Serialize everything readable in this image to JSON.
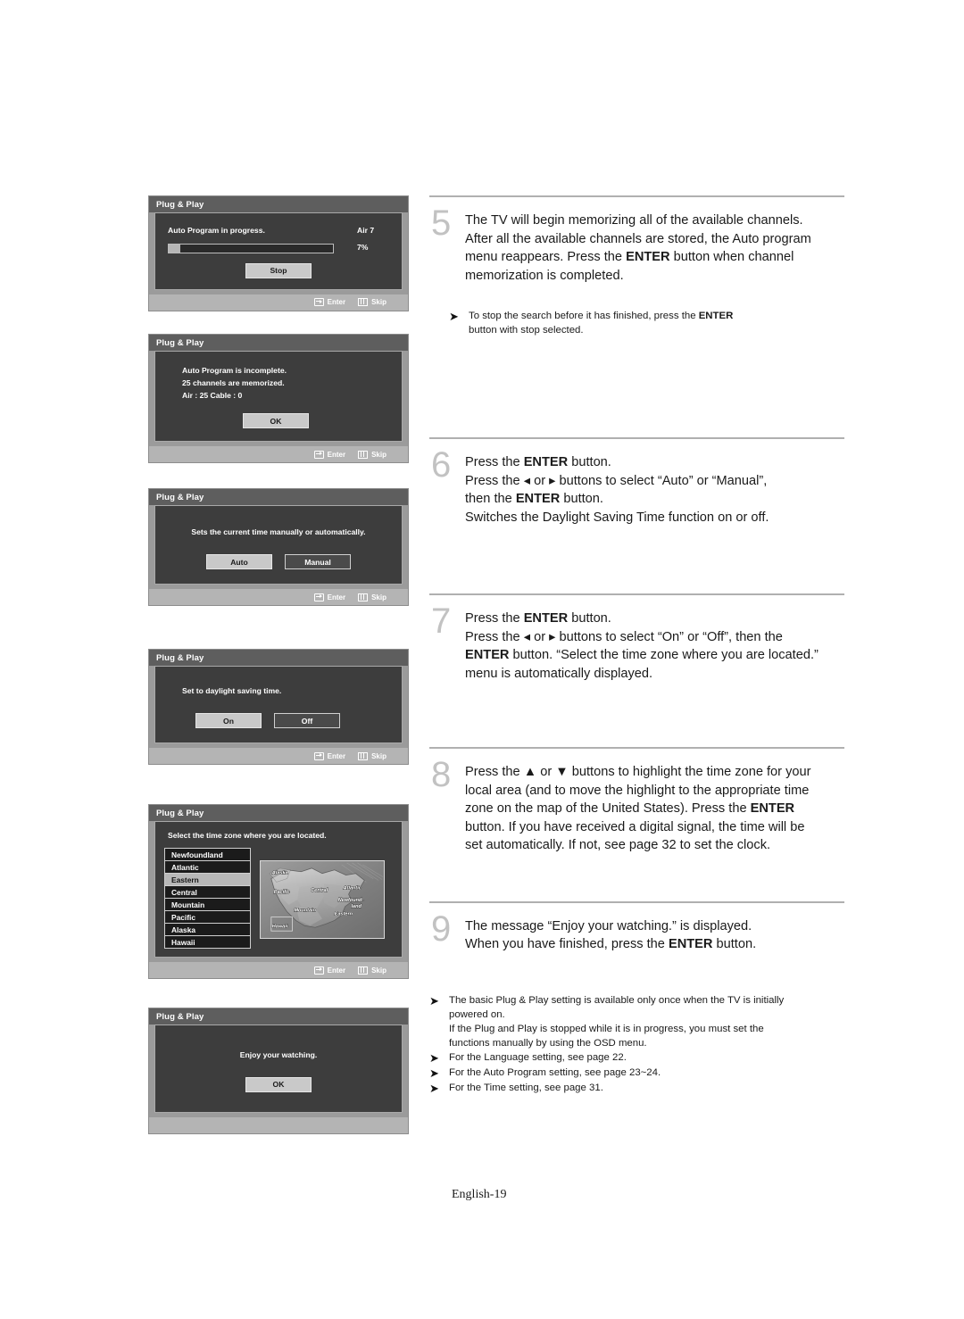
{
  "page": {
    "footer": "English-19"
  },
  "osd": {
    "title": "Plug & Play",
    "footer": {
      "enter": "Enter",
      "skip": "Skip"
    },
    "dialog_auto_program": {
      "message": "Auto Program in progress.",
      "channel": "Air 7",
      "percent": "7%",
      "progress_value": 7,
      "button": "Stop"
    },
    "dialog_incomplete": {
      "line1": "Auto Program is incomplete.",
      "line2": "25 channels are memorized.",
      "line3": "Air : 25    Cable : 0",
      "button": "OK"
    },
    "dialog_clock_mode": {
      "message": "Sets the current time manually or automatically.",
      "option_selected": "Auto",
      "option_other": "Manual"
    },
    "dialog_dst": {
      "message": "Set to daylight saving time.",
      "option_selected": "On",
      "option_other": "Off"
    },
    "dialog_timezone": {
      "message": "Select the time zone where you are located.",
      "items": [
        "Newfoundland",
        "Atlantic",
        "Eastern",
        "Central",
        "Mountain",
        "Pacific",
        "Alaska",
        "Hawaii"
      ],
      "selected_index": 2,
      "map_labels": [
        "Alaska",
        "Pacific",
        "Central",
        "Atlantic",
        "Newfound-",
        "land",
        "Mountain",
        "Eastern",
        "Hawaii"
      ]
    },
    "dialog_enjoy": {
      "message": "Enjoy your watching.",
      "button": "OK"
    }
  },
  "steps": [
    {
      "number": "5",
      "line1": "The TV will begin memorizing all of the available channels.",
      "line2": "After all the available channels are stored, the Auto program",
      "line3_a": "menu reappears. Press the ",
      "line3_b": "ENTER",
      "line3_c": " button when channel",
      "line4": "memorization is completed.",
      "note_a": "To stop the search before it has finished, press the ",
      "note_b": "ENTER",
      "note_c": "button with stop selected."
    },
    {
      "number": "6",
      "l1_a": "Press the ",
      "l1_b": "ENTER",
      "l1_c": " button.",
      "l2_a": "Press the ",
      "l2_b": " or ",
      "l2_c": " buttons to select “Auto” or “Manual”,",
      "l3_a": "then the ",
      "l3_b": "ENTER",
      "l3_c": " button.",
      "l4": "Switches the Daylight Saving Time function on or off."
    },
    {
      "number": "7",
      "l1_a": "Press the ",
      "l1_b": "ENTER",
      "l1_c": " button.",
      "l2_a": "Press the ",
      "l2_b": " or ",
      "l2_c": " buttons to select “On” or “Off”, then the",
      "l3_a": "ENTER",
      "l3_b": " button. “Select the time zone where you are located.”",
      "l4": "menu is automatically displayed."
    },
    {
      "number": "8",
      "l1_a": "Press the ",
      "l1_b": " or ",
      "l1_c": " buttons to highlight the time zone for your",
      "l2": "local area (and to move the highlight to the appropriate time",
      "l3_a": "zone on the map of the United States). Press the ",
      "l3_b": "ENTER",
      "l4": "button. If you have received a digital signal, the time will be",
      "l5": "set automatically. If not, see page 32 to set the clock."
    },
    {
      "number": "9",
      "l1": "The message “Enjoy your watching.” is displayed.",
      "l2_a": "When you have finished, press the ",
      "l2_b": "ENTER",
      "l2_c": " button."
    }
  ],
  "final_notes": [
    {
      "line1": "The basic Plug & Play setting is available only once when the TV is initially",
      "line2": "powered on.",
      "line3": "If the Plug and Play is stopped while it is in progress, you must set the",
      "line4": "functions manually by using the OSD menu."
    },
    {
      "line1": "For the Language setting, see page 22."
    },
    {
      "line1": "For the Auto Program setting, see page 23~24."
    },
    {
      "line1": "For the Time setting, see page 31."
    }
  ]
}
